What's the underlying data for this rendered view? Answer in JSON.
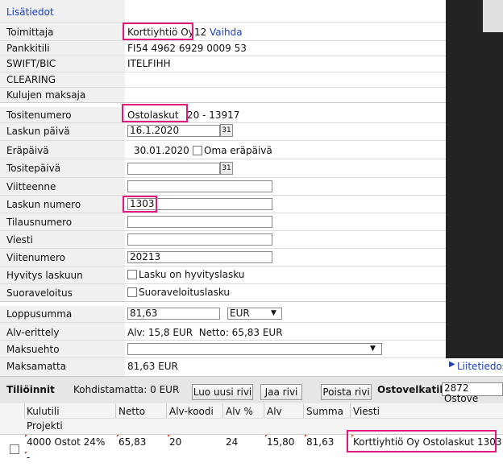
{
  "supplier_section": {
    "details_link": "Lisätiedot",
    "supplier_label": "Toimittaja",
    "supplier_name": "Korttiyhtiö Oy",
    "supplier_num": "12",
    "change_link": "Vaihda",
    "bank_label": "Pankkitili",
    "bank_value": "FI54 4962 6929 0009 53",
    "swift_label": "SWIFT/BIC",
    "swift_value": "ITELFIHH",
    "clearing_label": "CLEARING",
    "fee_label": "Kulujen maksaja"
  },
  "invoice": {
    "voucher_no_label": "Tositenumero",
    "voucher_prefix": "Ostolaskut",
    "voucher_rest": "20 - 13917",
    "date_label": "Laskun päivä",
    "date_value": "16.1.2020",
    "cal_icon_text": "31",
    "due_label": "Eräpäivä",
    "due_value": "30.01.2020",
    "own_due_label": "Oma eräpäivä",
    "voucher_date_label": "Tositepäivä",
    "voucher_date_value": "",
    "reference_label": "Viitteenne",
    "reference_value": "",
    "invoice_no_label": "Laskun numero",
    "invoice_no_value": "1303",
    "order_no_label": "Tilausnumero",
    "order_no_value": "",
    "message_label": "Viesti",
    "message_value": "",
    "ref_no_label": "Viitenumero",
    "ref_no_value": "20213",
    "credit_label": "Hyvitys laskuun",
    "credit_cb_label": "Lasku on hyvityslasku",
    "direct_label": "Suoraveloitus",
    "direct_cb_label": "Suoraveloituslasku",
    "total_label": "Loppusumma",
    "total_value": "81,63",
    "currency_value": "EUR",
    "vat_label": "Alv-erittely",
    "vat_value": "Alv: 15,8 EUR  Netto: 65,83 EUR",
    "terms_label": "Maksuehto",
    "terms_value": "",
    "unpaid_label": "Maksamatta",
    "unpaid_value": "81,63 EUR",
    "attachments_link": "Liitetiedost"
  },
  "accounts_bar": {
    "title": "Tiliöinnit",
    "unallocated": "Kohdistamatta: 0 EUR",
    "new_row_btn": "Luo uusi rivi",
    "split_btn": "Jaa rivi",
    "delete_btn": "Poista rivi",
    "payables_label": "Ostovelkatili",
    "payables_value": "2872 Ostove"
  },
  "table": {
    "headers": [
      "Kulutili",
      "Netto",
      "Alv-koodi",
      "Alv %",
      "Alv",
      "Summa",
      "Viesti"
    ],
    "subheader": "Projekti",
    "row": {
      "account": "4000 Ostot 24%",
      "net": "65,83",
      "vat_code": "20",
      "vat_pct": "24",
      "vat": "15,80",
      "sum": "81,63",
      "message": "Korttiyhtiö Oy Ostolaskut 1303"
    },
    "project_value": "-"
  },
  "colors": {
    "highlight": "#e0197d",
    "link": "#1a3fbf",
    "label_bg": "#f0f0f0",
    "dark_panel": "#232323"
  }
}
